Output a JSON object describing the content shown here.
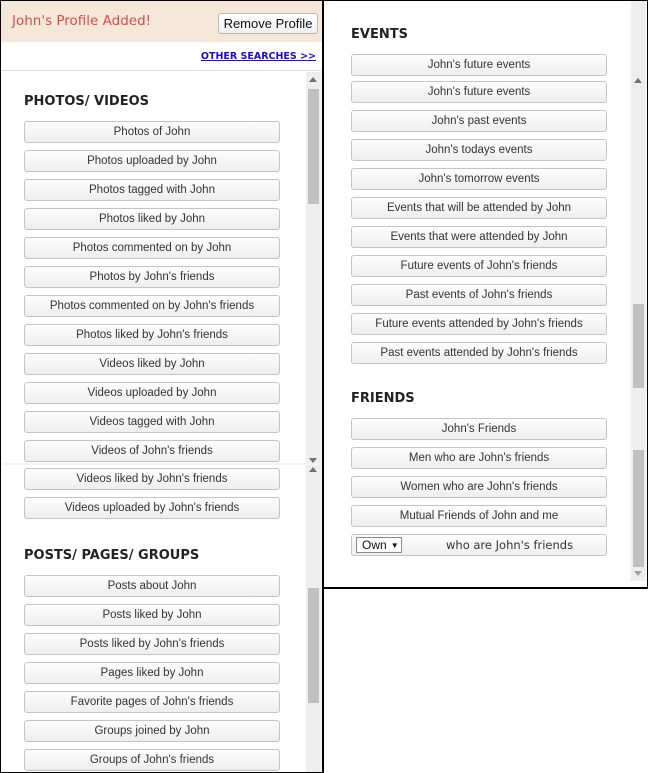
{
  "banner": {
    "message": "John's Profile Added!",
    "remove_button": "Remove Profile",
    "message_color": "#d94b4b",
    "background": "#f5e8d8"
  },
  "other_searches_link": "OTHER SEARCHES >>",
  "left_panel": {
    "photos_videos": {
      "title": "PHOTOS/ VIDEOS",
      "buttons": [
        "Photos of John",
        "Photos uploaded by John",
        "Photos tagged with John",
        "Photos liked by John",
        "Photos commented on by John",
        "Photos by John's friends",
        "Photos commented on by John's friends",
        "Photos liked by John's friends",
        "Videos liked by John",
        "Videos uploaded by John",
        "Videos tagged with John",
        "Videos of John's friends",
        "Videos liked by John's friends",
        "Videos uploaded by John's friends"
      ]
    },
    "posts_pages_groups": {
      "title": "POSTS/ PAGES/ GROUPS",
      "buttons": [
        "Posts about John",
        "Posts liked by John",
        "Posts liked by John's friends",
        "Pages liked by John",
        "Favorite pages of John's friends",
        "Groups joined by John",
        "Groups of John's friends"
      ]
    }
  },
  "right_panel": {
    "events": {
      "title": "EVENTS",
      "buttons": [
        "John's future events",
        "John's future events",
        "John's past events",
        "John's todays events",
        "John's tomorrow events",
        "Events that will be attended by John",
        "Events that were attended by John",
        "Future events of John's friends",
        "Past events of John's friends",
        "Future events attended by John's friends",
        "Past events attended by John's friends"
      ]
    },
    "friends": {
      "title": "FRIENDS",
      "buttons": [
        "John's Friends",
        "Men who are John's friends",
        "Women who are John's friends",
        "Mutual Friends of John and me"
      ],
      "relation_select": {
        "selected": "Own",
        "suffix": "who are John's friends"
      }
    }
  }
}
